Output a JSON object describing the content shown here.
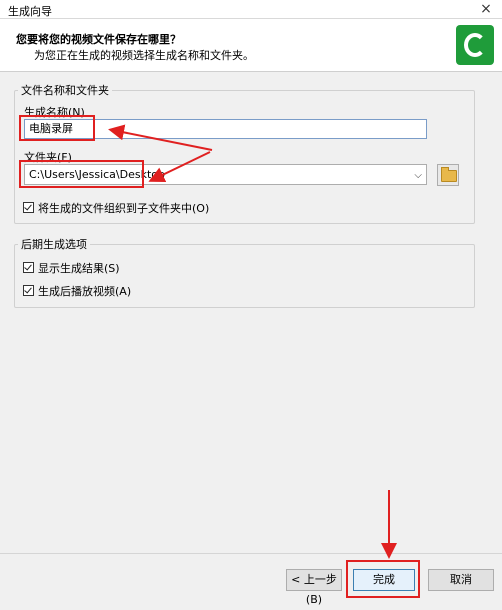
{
  "window": {
    "title": "生成向导",
    "close_glyph": "×"
  },
  "header": {
    "question": "您要将您的视频文件保存在哪里？",
    "subtitle": "为您正在生成的视频选择生成名称和文件夹。"
  },
  "group_file": {
    "legend": "文件名称和文件夹",
    "name_label": "生成名称(N)",
    "name_value": "电脑录屏",
    "folder_label": "文件夹(F)",
    "folder_value": "C:\\Users\\Jessica\\Desktop",
    "organize_label": "将生成的文件组织到子文件夹中(O)",
    "organize_checked": true
  },
  "group_post": {
    "legend": "后期生成选项",
    "show_results_label": "显示生成结果(S)",
    "show_results_checked": true,
    "play_after_label": "生成后播放视频(A)",
    "play_after_checked": true
  },
  "buttons": {
    "back": "< 上一步(B)",
    "finish": "完成",
    "cancel": "取消"
  },
  "icons": {
    "logo": "camtasia-logo-icon",
    "browse": "folder-icon",
    "dropdown": "chevron-down-icon"
  },
  "colors": {
    "annotation": "#e02020",
    "logo": "#1f9c3a"
  }
}
